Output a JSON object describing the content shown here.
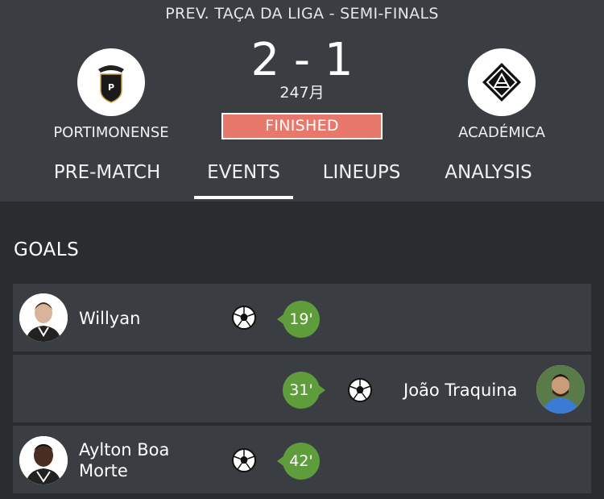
{
  "competition": "PREV. TAÇA DA LIGA - SEMI-FINALS",
  "match": {
    "home_team": "PORTIMONENSE",
    "away_team": "ACADÉMICA",
    "score": "2 - 1",
    "date": "247月",
    "status": "FINISHED",
    "status_color": "#e8786c"
  },
  "tabs": [
    {
      "label": "PRE-MATCH"
    },
    {
      "label": "EVENTS",
      "active": true
    },
    {
      "label": "LINEUPS"
    },
    {
      "label": "ANALYSIS"
    }
  ],
  "goals_section": {
    "title": "GOALS",
    "events": [
      {
        "player": "Willyan",
        "minute": "19'",
        "side": "home",
        "icon": "soccer-ball-icon"
      },
      {
        "player": "João Traquina",
        "minute": "31'",
        "side": "away",
        "icon": "soccer-ball-icon"
      },
      {
        "player": "Aylton Boa Morte",
        "player_line1": "Aylton Boa",
        "player_line2": "Morte",
        "minute": "42'",
        "side": "home",
        "icon": "soccer-ball-icon"
      }
    ]
  },
  "colors": {
    "header_bg": "#3a3d42",
    "page_bg": "#2a2c30",
    "minute_badge": "#5e9c3c"
  }
}
